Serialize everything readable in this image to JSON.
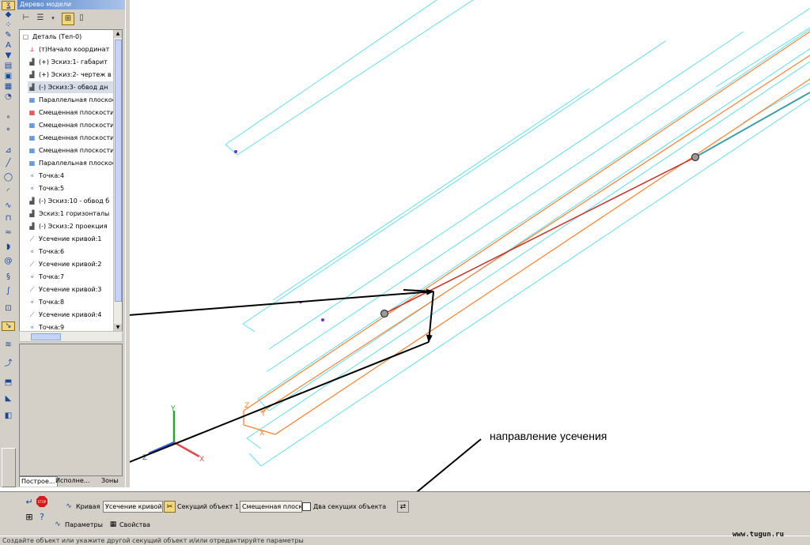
{
  "tree": {
    "title": "Дерево модели",
    "items": [
      {
        "label": "Деталь (Тел-0)",
        "icon": "part-icon"
      },
      {
        "label": "(т)Начало координат",
        "icon": "origin-icon"
      },
      {
        "label": "(+) Эскиз:1- габарит",
        "icon": "sketch-icon"
      },
      {
        "label": "(+) Эскиз:2- чертеж в",
        "icon": "sketch-icon"
      },
      {
        "label": "(-) Эскиз:3- обвод дн",
        "icon": "sketch-icon"
      },
      {
        "label": "Параллельная плоскос",
        "icon": "plane-icon"
      },
      {
        "label": "Смещенная плоскости",
        "icon": "plane-red-icon"
      },
      {
        "label": "Смещенная плоскости",
        "icon": "plane-icon"
      },
      {
        "label": "Смещенная плоскости",
        "icon": "plane-icon"
      },
      {
        "label": "Смещенная плоскости",
        "icon": "plane-icon"
      },
      {
        "label": "Параллельная плоскос",
        "icon": "plane-icon"
      },
      {
        "label": "Точка:4",
        "icon": "point-icon"
      },
      {
        "label": "Точка:5",
        "icon": "point-icon"
      },
      {
        "label": "(-) Эскиз:10 - обвод б",
        "icon": "sketch-icon"
      },
      {
        "label": "Эскиз:1 горизонталы",
        "icon": "sketch-icon"
      },
      {
        "label": "(-) Эскиз:2 проекция",
        "icon": "sketch-icon"
      },
      {
        "label": "Усечение кривой:1",
        "icon": "trim-curve-icon"
      },
      {
        "label": "Точка:6",
        "icon": "point-icon"
      },
      {
        "label": "Усечение кривой:2",
        "icon": "trim-curve-icon"
      },
      {
        "label": "Точка:7",
        "icon": "point-icon"
      },
      {
        "label": "Усечение кривой:3",
        "icon": "trim-curve-icon"
      },
      {
        "label": "Точка:8",
        "icon": "point-icon"
      },
      {
        "label": "Усечение кривой:4",
        "icon": "trim-curve-icon"
      },
      {
        "label": "Точка:9",
        "icon": "point-icon"
      }
    ],
    "tabs": [
      "Построе...",
      "Исполне...",
      "Зоны"
    ]
  },
  "viewport": {
    "axis_x": "X",
    "axis_y": "Y",
    "axis_z": "Z",
    "annotation": "направление усечения",
    "colors": {
      "sketch": "#5ee0ee",
      "edge": "#ff7f2a",
      "trim": "#d0281e",
      "arrow": "#000000"
    }
  },
  "propbar": {
    "curve_label": "Кривая",
    "curve_value": "Усечение кривой",
    "cutter_label": "Секущий объект 1",
    "cutter_value": "Смещенная плоско",
    "two_cutters_label": "Два секущих объекта",
    "tab_params": "Параметры",
    "tab_props": "Свойства"
  },
  "status": {
    "text": "Создайте объект или укажите другой секущий объект и/или отредактируйте параметры"
  },
  "watermark": "www.tugun.ru"
}
